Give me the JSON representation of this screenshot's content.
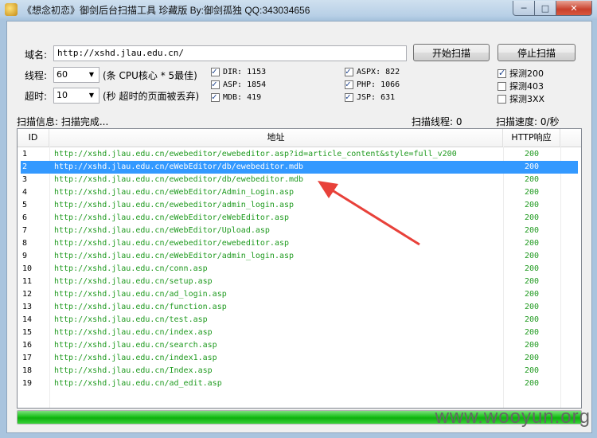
{
  "window": {
    "title": "《想念初恋》御剑后台扫描工具 珍藏版 By:御剑孤独 QQ:343034656",
    "min": "─",
    "max": "□",
    "close": "✕"
  },
  "form": {
    "domain_label": "域名:",
    "domain_value": "http://xshd.jlau.edu.cn/",
    "threads_label": "线程:",
    "threads_value": "60",
    "threads_hint": "(条 CPU核心 * 5最佳)",
    "timeout_label": "超时:",
    "timeout_value": "10",
    "timeout_hint": "(秒 超时的页面被丢弃)",
    "start_button": "开始扫描",
    "stop_button": "停止扫描"
  },
  "dicts": [
    {
      "label": "DIR: 1153",
      "checked": true
    },
    {
      "label": "ASP: 1854",
      "checked": true
    },
    {
      "label": "MDB: 419",
      "checked": true
    },
    {
      "label": "ASPX: 822",
      "checked": true
    },
    {
      "label": "PHP: 1066",
      "checked": true
    },
    {
      "label": "JSP: 631",
      "checked": true
    }
  ],
  "probes": [
    {
      "label": "探测200",
      "checked": true
    },
    {
      "label": "探测403",
      "checked": false
    },
    {
      "label": "探测3XX",
      "checked": false
    }
  ],
  "status": {
    "info": "扫描信息: 扫描完成...",
    "threads": "扫描线程: 0",
    "speed": "扫描速度: 0/秒"
  },
  "table": {
    "headers": [
      "ID",
      "地址",
      "HTTP响应"
    ],
    "selected_index": 1,
    "rows": [
      {
        "id": "1",
        "url": "http://xshd.jlau.edu.cn/ewebeditor/ewebeditor.asp?id=article_content&style=full_v200",
        "code": "200"
      },
      {
        "id": "2",
        "url": "http://xshd.jlau.edu.cn/eWebEditor/db/ewebeditor.mdb",
        "code": "200"
      },
      {
        "id": "3",
        "url": "http://xshd.jlau.edu.cn/ewebeditor/db/ewebeditor.mdb",
        "code": "200"
      },
      {
        "id": "4",
        "url": "http://xshd.jlau.edu.cn/eWebEditor/Admin_Login.asp",
        "code": "200"
      },
      {
        "id": "5",
        "url": "http://xshd.jlau.edu.cn/ewebeditor/admin_login.asp",
        "code": "200"
      },
      {
        "id": "6",
        "url": "http://xshd.jlau.edu.cn/eWebEditor/eWebEditor.asp",
        "code": "200"
      },
      {
        "id": "7",
        "url": "http://xshd.jlau.edu.cn/eWebEditor/Upload.asp",
        "code": "200"
      },
      {
        "id": "8",
        "url": "http://xshd.jlau.edu.cn/ewebeditor/ewebeditor.asp",
        "code": "200"
      },
      {
        "id": "9",
        "url": "http://xshd.jlau.edu.cn/eWebEditor/admin_login.asp",
        "code": "200"
      },
      {
        "id": "10",
        "url": "http://xshd.jlau.edu.cn/conn.asp",
        "code": "200"
      },
      {
        "id": "11",
        "url": "http://xshd.jlau.edu.cn/setup.asp",
        "code": "200"
      },
      {
        "id": "12",
        "url": "http://xshd.jlau.edu.cn/ad_login.asp",
        "code": "200"
      },
      {
        "id": "13",
        "url": "http://xshd.jlau.edu.cn/function.asp",
        "code": "200"
      },
      {
        "id": "14",
        "url": "http://xshd.jlau.edu.cn/test.asp",
        "code": "200"
      },
      {
        "id": "15",
        "url": "http://xshd.jlau.edu.cn/index.asp",
        "code": "200"
      },
      {
        "id": "16",
        "url": "http://xshd.jlau.edu.cn/search.asp",
        "code": "200"
      },
      {
        "id": "17",
        "url": "http://xshd.jlau.edu.cn/index1.asp",
        "code": "200"
      },
      {
        "id": "18",
        "url": "http://xshd.jlau.edu.cn/Index.asp",
        "code": "200"
      },
      {
        "id": "19",
        "url": "http://xshd.jlau.edu.cn/ad_edit.asp",
        "code": "200"
      }
    ]
  },
  "progress": {
    "fraction": 1.0
  },
  "colors": {
    "url_text": "#1f9a1f",
    "selection": "#3399ff",
    "progress": "#1cc21c",
    "arrow": "#e8413a"
  },
  "watermark": "www.wooyun.org"
}
